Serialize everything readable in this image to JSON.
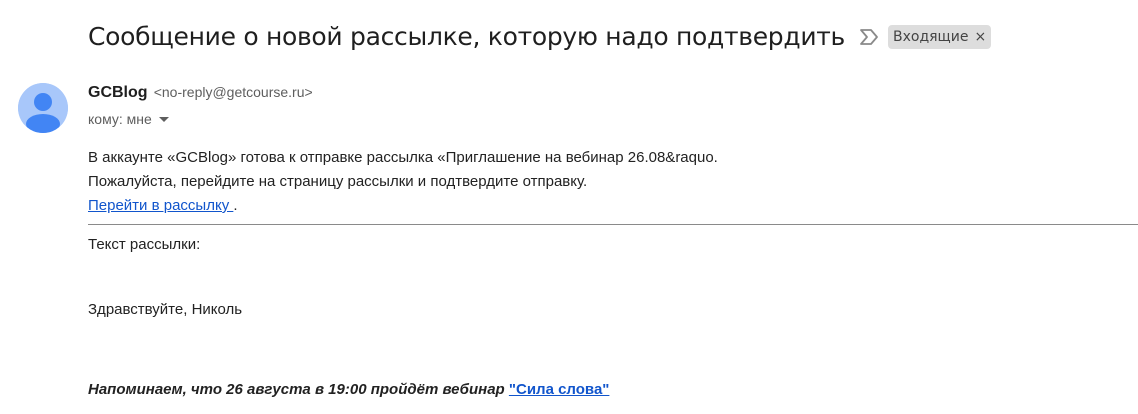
{
  "email": {
    "subject": "Сообщение о новой рассылке, которую надо подтвердить",
    "label": "Входящие",
    "label_close": "×",
    "important_icon": "important-marker-icon",
    "avatar_icon": "person-silhouette-icon",
    "avatar_color": "#a8c7fa",
    "avatar_figure_color": "#4285f4"
  },
  "sender": {
    "name": "GCBlog",
    "email": "<no-reply@getcourse.ru>",
    "recipient": "кому: мне"
  },
  "body": {
    "line1": "В аккаунте «GCBlog» готова к отправке рассылка «Приглашение на вебинар 26.08&raquo.",
    "line2": "Пожалуйста, перейдите на страницу рассылки и подтвердите отправку.",
    "link_text": "Перейти в рассылку ",
    "link_suffix": ".",
    "text_label": "Текст рассылки:",
    "greeting": "Здравствуйте, Николь",
    "reminder_text": "Напоминаем, что 26 августа в 19:00 пройдёт вебинар ",
    "reminder_link": "\"Сила слова\""
  },
  "colors": {
    "link": "#1155cc",
    "chip_bg": "#dddddd"
  }
}
